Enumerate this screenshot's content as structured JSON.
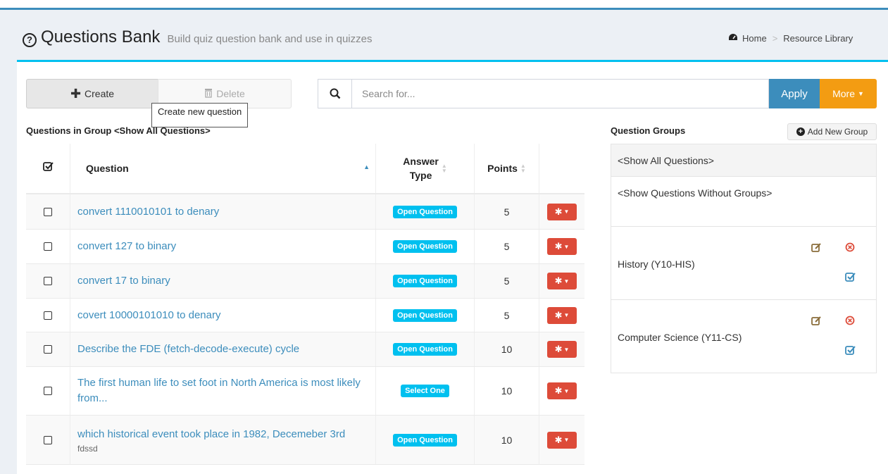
{
  "header": {
    "title": "Questions Bank",
    "subtitle": "Build quiz question bank and use in quizzes",
    "breadcrumb": {
      "home": "Home",
      "separator": ">",
      "current": "Resource Library"
    }
  },
  "toolbar": {
    "create_label": "Create",
    "delete_label": "Delete",
    "tooltip": "Create new question",
    "search_placeholder": "Search for...",
    "apply_label": "Apply",
    "more_label": "More"
  },
  "questions": {
    "group_label": "Questions in Group <Show All Questions>",
    "headers": {
      "question": "Question",
      "answer_type_line1": "Answer",
      "answer_type_line2": "Type",
      "points": "Points"
    },
    "rows": [
      {
        "question": "convert 1110010101 to denary",
        "sub": "",
        "type": "Open Question",
        "points": "5"
      },
      {
        "question": "convert 127 to binary",
        "sub": "",
        "type": "Open Question",
        "points": "5"
      },
      {
        "question": "convert 17 to binary",
        "sub": "",
        "type": "Open Question",
        "points": "5"
      },
      {
        "question": "covert 10000101010 to denary",
        "sub": "",
        "type": "Open Question",
        "points": "5"
      },
      {
        "question": "Describe the FDE (fetch-decode-execute) cycle",
        "sub": "",
        "type": "Open Question",
        "points": "10"
      },
      {
        "question": "The first human life to set foot in North America is most likely from...",
        "sub": "",
        "type": "Select One",
        "points": "10"
      },
      {
        "question": "which historical event took place in 1982, Decemeber 3rd",
        "sub": "fdssd",
        "type": "Open Question",
        "points": "10"
      }
    ]
  },
  "groups": {
    "label": "Question Groups",
    "add_label": "Add New Group",
    "items": [
      {
        "name": "<Show All Questions>"
      },
      {
        "name": "<Show Questions Without Groups>"
      },
      {
        "name": "History (Y10-HIS)"
      },
      {
        "name": "Computer Science (Y11-CS)"
      }
    ]
  },
  "colors": {
    "primary": "#3c8dbc",
    "info": "#00c0ef",
    "warning": "#f39c12",
    "danger": "#dd4b39"
  }
}
